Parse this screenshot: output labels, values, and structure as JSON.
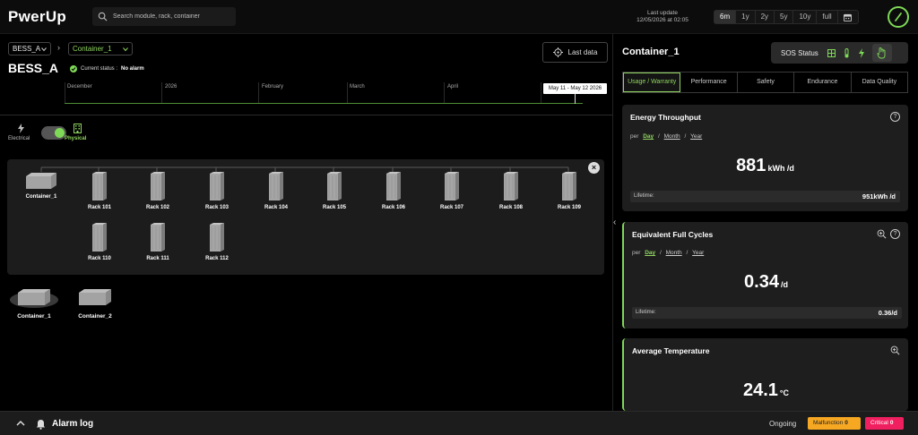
{
  "header": {
    "logo_text_pre": "P",
    "logo_text_w": "w",
    "logo_text_post": "erUp",
    "search_placeholder": "Search module, rack, container",
    "last_update_label": "Last update",
    "last_update_value": "12/05/2026 at 02:05",
    "ranges": [
      "6m",
      "1y",
      "2y",
      "5y",
      "10y",
      "full"
    ],
    "active_range": "6m"
  },
  "left": {
    "breadcrumb": [
      "BESS_A",
      "Container_1"
    ],
    "title": "BESS_A",
    "status_label": "Current status :",
    "status_value": "No alarm",
    "last_data_label": "Last data",
    "timeline_labels": [
      "December",
      "2026",
      "February",
      "March",
      "April"
    ],
    "timeline_range": "May 11 - May 12 2026",
    "toggle_left": "Electrical",
    "toggle_right": "Physical",
    "racks_top": [
      "Rack 101",
      "Rack 102",
      "Rack 103",
      "Rack 104",
      "Rack 105",
      "Rack 106",
      "Rack 107",
      "Rack 108",
      "Rack 109"
    ],
    "racks_bottom": [
      "Rack 110",
      "Rack 111",
      "Rack 112"
    ],
    "container_in_panel": "Container_1",
    "containers": [
      "Container_1",
      "Container_2"
    ]
  },
  "right": {
    "title": "Container_1",
    "sos_label": "SOS Status",
    "tabs": [
      "Usage / Warranty",
      "Performance",
      "Safety",
      "Endurance",
      "Data Quality"
    ],
    "active_tab": "Usage / Warranty",
    "per_label": "per",
    "period_options": [
      "Day",
      "Month",
      "Year"
    ],
    "period_sep": "/",
    "cards": [
      {
        "title": "Energy Throughput",
        "value": "881",
        "unit": "kWh /d",
        "lifetime_label": "Lifetime:",
        "lifetime_value": "951kWh /d"
      },
      {
        "title": "Equivalent Full Cycles",
        "value": "0.34",
        "unit": "/d",
        "lifetime_label": "Lifetime:",
        "lifetime_value": "0.36/d"
      },
      {
        "title": "Average Temperature",
        "value": "24.1",
        "unit": "°C"
      }
    ]
  },
  "footer": {
    "alarm_log": "Alarm log",
    "ongoing": "Ongoing",
    "malfunction_label": "Malfunction",
    "malfunction_count": "0",
    "critical_label": "Critical",
    "critical_count": "0"
  },
  "colors": {
    "accent": "#7ed957",
    "malfunction": "#f7a823",
    "critical": "#f02060"
  }
}
